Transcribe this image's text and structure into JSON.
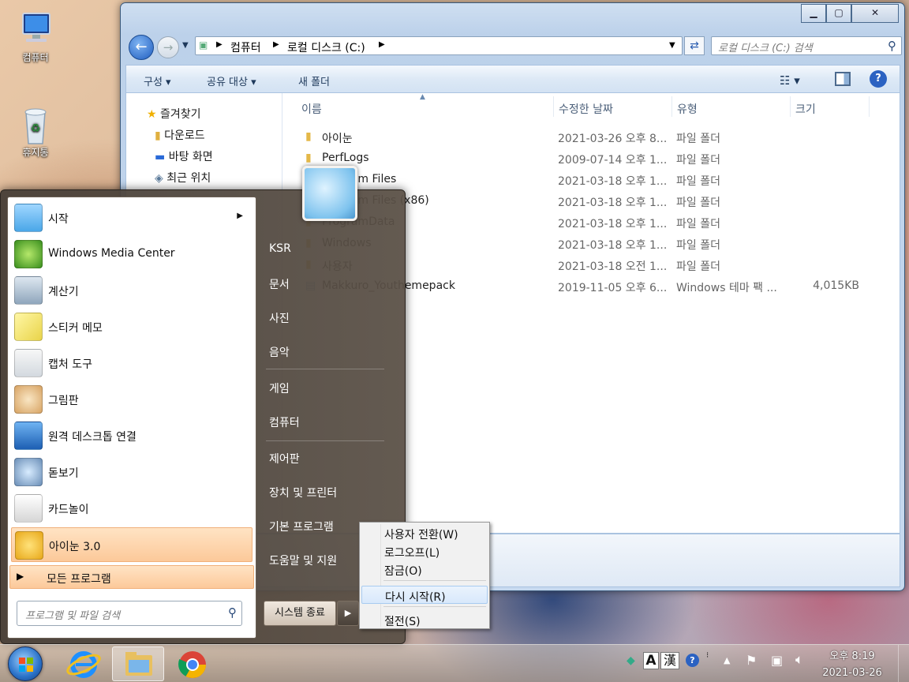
{
  "desktop": {
    "icons": [
      {
        "label": "컴퓨터"
      },
      {
        "label": "휴지통"
      }
    ]
  },
  "explorer": {
    "breadcrumb": [
      "컴퓨터",
      "로컬 디스크 (C:)"
    ],
    "search_placeholder": "로컬 디스크 (C:) 검색",
    "toolbar": {
      "organize": "구성",
      "share": "공유 대상",
      "new_folder": "새 폴더"
    },
    "nav": {
      "favorites": "즐겨찾기",
      "downloads": "다운로드",
      "desktop": "바탕 화면",
      "recent": "최근 위치"
    },
    "columns": {
      "name": "이름",
      "modified": "수정한 날짜",
      "type": "유형",
      "size": "크기"
    },
    "files": [
      {
        "name": "아이눈",
        "date": "2021-03-26 오후 8...",
        "type": "파일 폴더",
        "size": ""
      },
      {
        "name": "PerfLogs",
        "date": "2009-07-14 오후 1...",
        "type": "파일 폴더",
        "size": ""
      },
      {
        "name": "Program Files",
        "date": "2021-03-18 오후 1...",
        "type": "파일 폴더",
        "size": ""
      },
      {
        "name": "Program Files (x86)",
        "date": "2021-03-18 오후 1...",
        "type": "파일 폴더",
        "size": ""
      },
      {
        "name": "ProgramData",
        "date": "2021-03-18 오후 1...",
        "type": "파일 폴더",
        "size": ""
      },
      {
        "name": "Windows",
        "date": "2021-03-18 오후 1...",
        "type": "파일 폴더",
        "size": ""
      },
      {
        "name": "사용자",
        "date": "2021-03-18 오전 1...",
        "type": "파일 폴더",
        "size": ""
      },
      {
        "name": "Makkuro_Youthemepack",
        "date": "2019-11-05 오후 6...",
        "type": "Windows 테마 팩 ...",
        "size": "4,015KB"
      }
    ]
  },
  "startmenu": {
    "programs": [
      "시작",
      "Windows Media Center",
      "계산기",
      "스티커 메모",
      "캡처 도구",
      "그림판",
      "원격 데스크톱 연결",
      "돋보기",
      "카드놀이",
      "아이눈 3.0"
    ],
    "all_programs": "모든 프로그램",
    "search_placeholder": "프로그램 및 파일 검색",
    "right": [
      "KSR",
      "문서",
      "사진",
      "음악",
      "게임",
      "컴퓨터",
      "제어판",
      "장치 및 프린터",
      "기본 프로그램",
      "도움말 및 지원"
    ],
    "shutdown": "시스템 종료"
  },
  "context_menu": [
    "사용자 전환(W)",
    "로그오프(L)",
    "잠금(O)",
    "다시 시작(R)",
    "절전(S)"
  ],
  "taskbar": {
    "time": "오후 8:19",
    "date": "2021-03-26",
    "ime": "A",
    "hanja": "漢"
  }
}
